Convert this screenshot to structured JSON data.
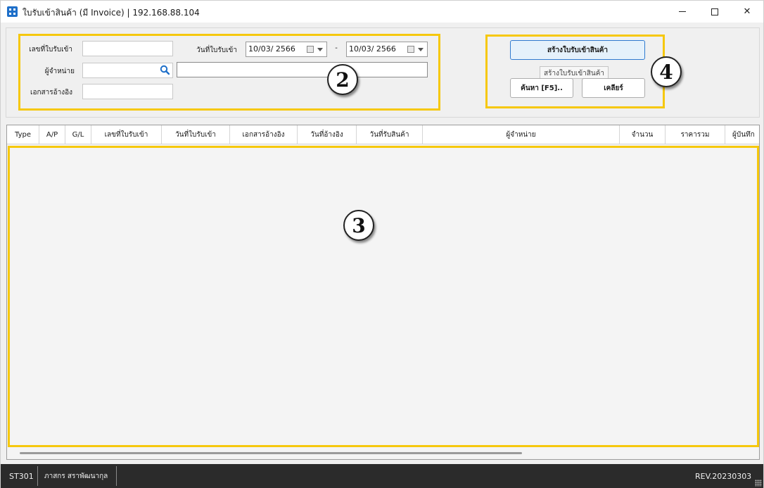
{
  "window": {
    "title": "ใบรับเข้าสินค้า (มี Invoice) | 192.168.88.104",
    "minimize": "—",
    "maximize": "☐",
    "close": "✕"
  },
  "filters": {
    "receipt_no_label": "เลขที่ใบรับเข้า",
    "receipt_no_value": "",
    "vendor_label": "ผู้จำหน่าย",
    "vendor_code_value": "",
    "vendor_name_value": "",
    "reference_label": "เอกสารอ้างอิง",
    "reference_value": "",
    "receipt_date_label": "วันที่ใบรับเข้า",
    "date_from": "10/03/  2566",
    "date_separator": "-",
    "date_to": "10/03/  2566"
  },
  "actions": {
    "create_label": "สร้างใบรับเข้าสินค้า",
    "create_tooltip": "สร้างใบรับเข้าสินค้า",
    "search_label": "ค้นหา [F5]..",
    "clear_label": "เคลียร์"
  },
  "grid": {
    "columns": [
      "Type",
      "A/P",
      "G/L",
      "เลขที่ใบรับเข้า",
      "วันที่ใบรับเข้า",
      "เอกสารอ้างอิง",
      "วันที่อ้างอิง",
      "วันที่รับสินค้า",
      "ผู้จำหน่าย",
      "จำนวน",
      "ราคารวม",
      "ผู้บันทึก"
    ]
  },
  "callouts": {
    "filters": "2",
    "grid": "3",
    "actions": "4"
  },
  "status": {
    "form_code": "ST301",
    "user_name": "ภาสกร สราพัฒนากุล",
    "revision": "REV.20230303"
  },
  "colors": {
    "highlight": "#f6c80d",
    "status_bar": "#2b2b2b",
    "primary_button": "#e5f1fb",
    "search_icon": "#1e6fc9"
  }
}
